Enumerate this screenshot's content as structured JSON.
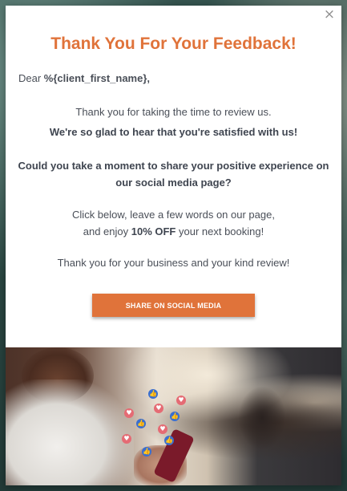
{
  "modal": {
    "close_symbol": "×",
    "title": "Thank You For Your Feedback!",
    "greeting_prefix": "Dear ",
    "greeting_placeholder": "%{client_first_name},",
    "line1": "Thank you for taking the time to review us.",
    "line2": "We're so glad to hear that you're satisfied with us!",
    "question_line1": "Could you take a moment to share your positive experience on",
    "question_line2": "our social media page?",
    "click_line1": "Click below, leave a few words on our page,",
    "click_line2_prefix": "and enjoy ",
    "discount": "10% OFF",
    "click_line2_suffix": " your next booking!",
    "thanks_line": "Thank you for your business and your kind review!",
    "cta_label": "SHARE ON SOCIAL MEDIA"
  },
  "photo": {
    "reaction_icons": [
      "heart-icon",
      "like-icon"
    ],
    "heart_glyph": "♥",
    "like_glyph": "👍"
  },
  "colors": {
    "accent": "#e0733a",
    "text": "#4a4f58",
    "heart": "#e56b74",
    "like": "#3a6fd0"
  }
}
